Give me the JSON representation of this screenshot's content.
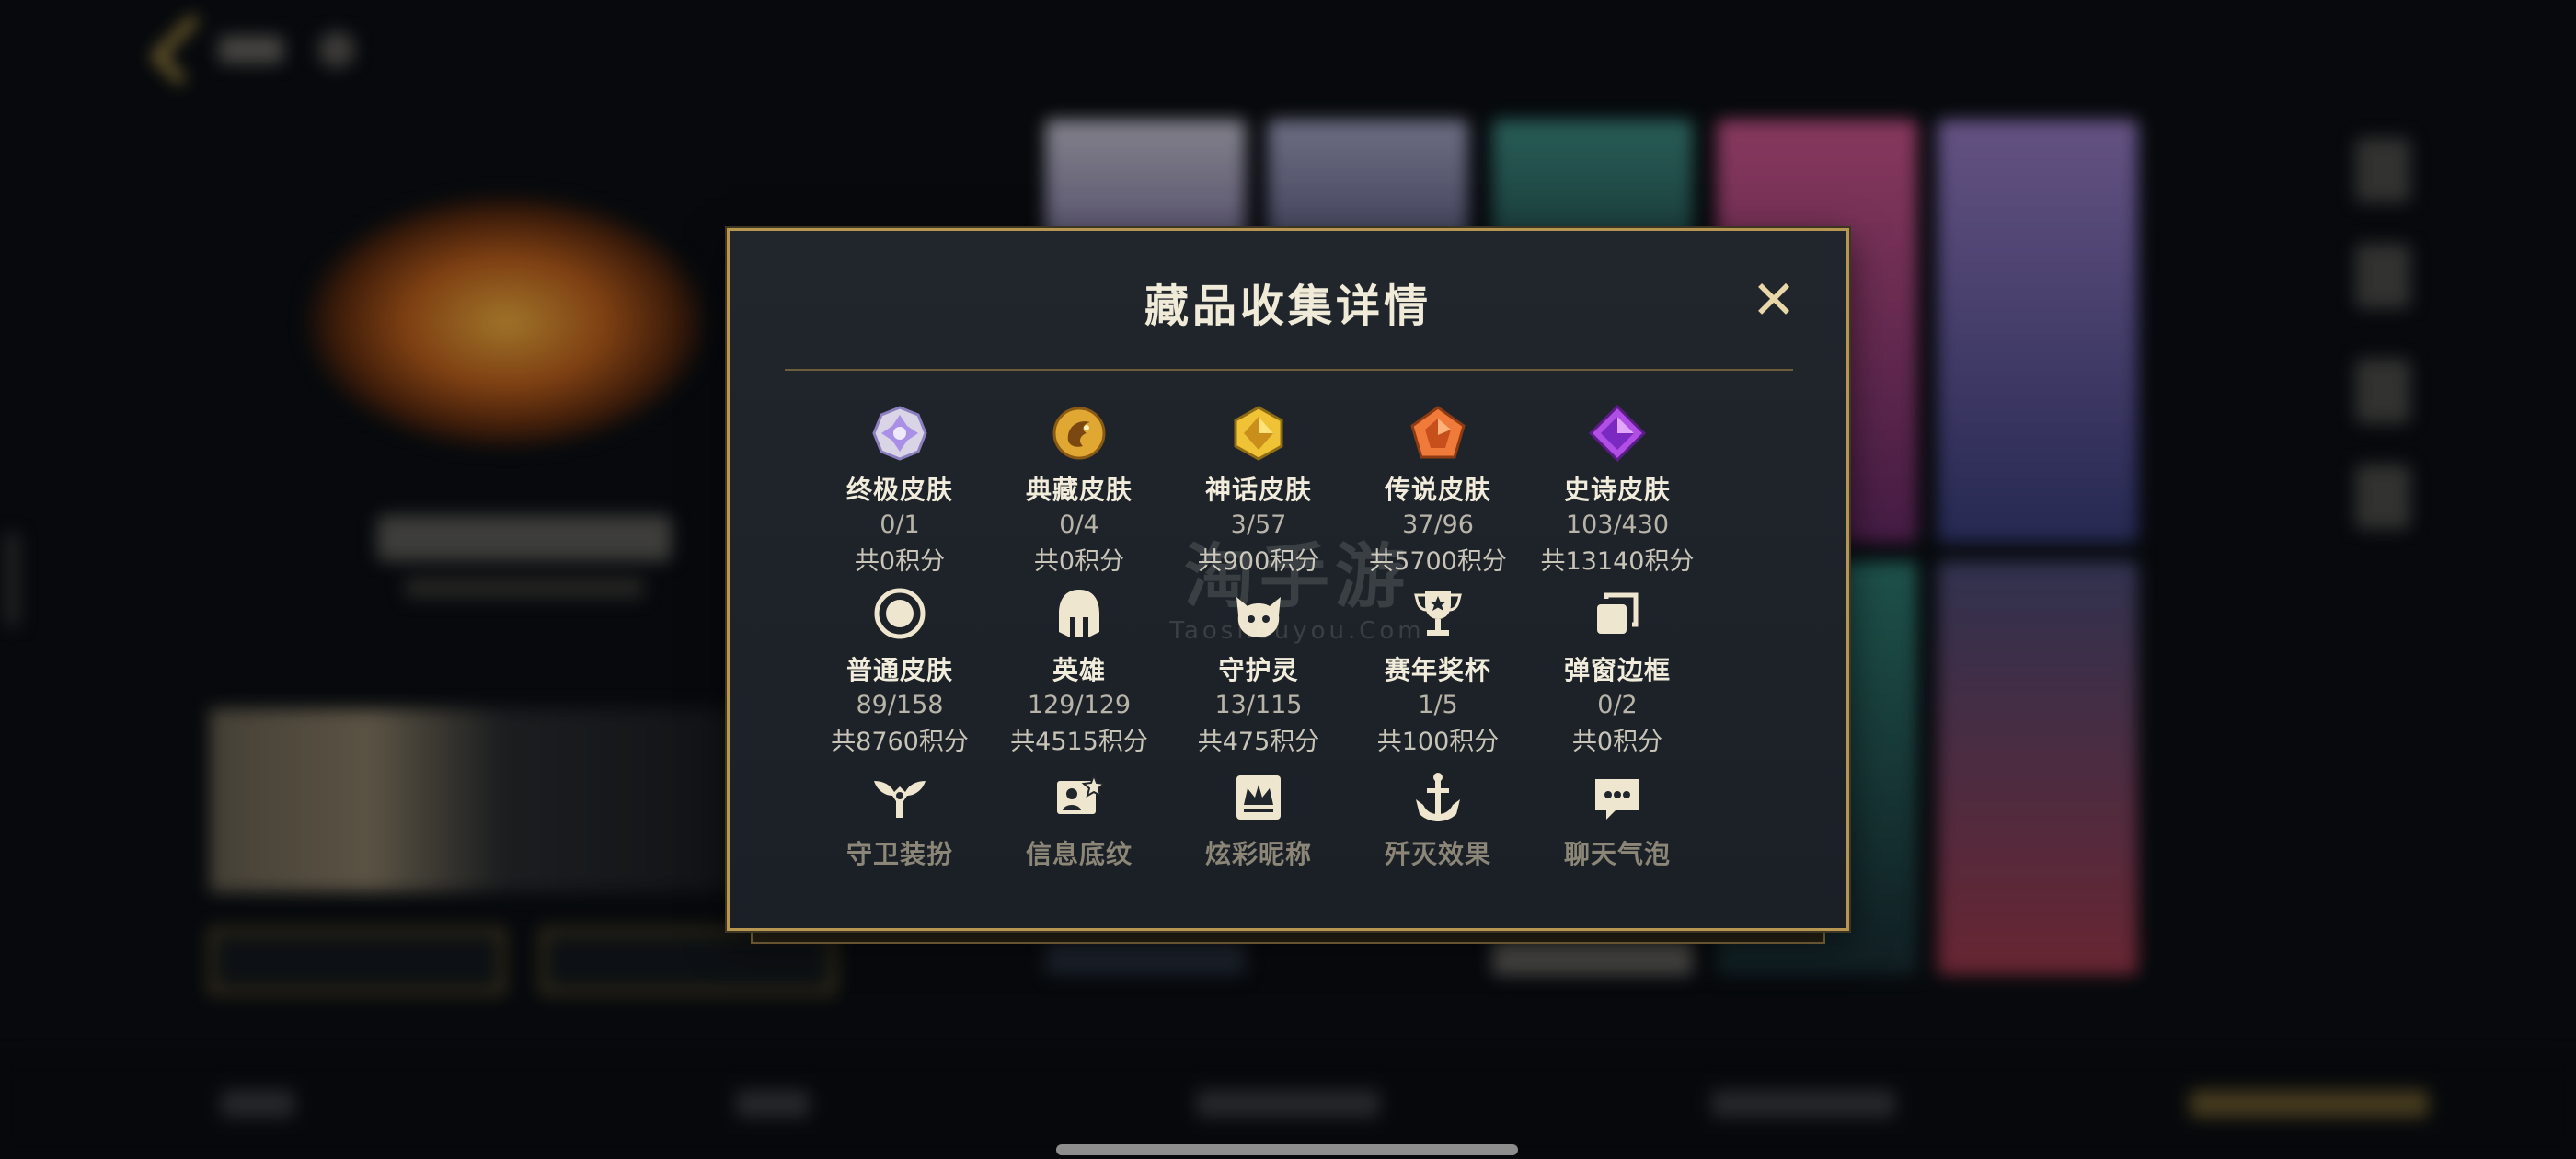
{
  "modal": {
    "title": "藏品收集详情",
    "close_label": "✕",
    "items": [
      {
        "label": "终极皮肤",
        "count": "0/1",
        "points": "共0积分",
        "icon": "ultimate-skin-icon"
      },
      {
        "label": "典藏皮肤",
        "count": "0/4",
        "points": "共0积分",
        "icon": "collector-skin-icon"
      },
      {
        "label": "神话皮肤",
        "count": "3/57",
        "points": "共900积分",
        "icon": "mythic-skin-icon"
      },
      {
        "label": "传说皮肤",
        "count": "37/96",
        "points": "共5700积分",
        "icon": "legendary-skin-icon"
      },
      {
        "label": "史诗皮肤",
        "count": "103/430",
        "points": "共13140积分",
        "icon": "epic-skin-icon"
      },
      {
        "label": "普通皮肤",
        "count": "89/158",
        "points": "共8760积分",
        "icon": "normal-skin-icon"
      },
      {
        "label": "英雄",
        "count": "129/129",
        "points": "共4515积分",
        "icon": "hero-helmet-icon"
      },
      {
        "label": "守护灵",
        "count": "13/115",
        "points": "共475积分",
        "icon": "guardian-spirit-icon"
      },
      {
        "label": "赛年奖杯",
        "count": "1/5",
        "points": "共100积分",
        "icon": "trophy-icon"
      },
      {
        "label": "弹窗边框",
        "count": "0/2",
        "points": "共0积分",
        "icon": "popup-frame-icon"
      },
      {
        "label": "守卫装扮",
        "icon": "guard-outfit-icon"
      },
      {
        "label": "信息底纹",
        "icon": "info-background-icon"
      },
      {
        "label": "炫彩昵称",
        "icon": "colorful-nickname-icon"
      },
      {
        "label": "歼灭效果",
        "icon": "annihilation-effect-icon"
      },
      {
        "label": "聊天气泡",
        "icon": "chat-bubble-icon"
      }
    ]
  },
  "watermark": {
    "main": "淘手游",
    "sub": "Taoshouyou.Com"
  },
  "colors": {
    "gold": "#b69651",
    "panel": "#1d2328",
    "text": "#f2ecdc",
    "muted": "#b8b4aa"
  }
}
